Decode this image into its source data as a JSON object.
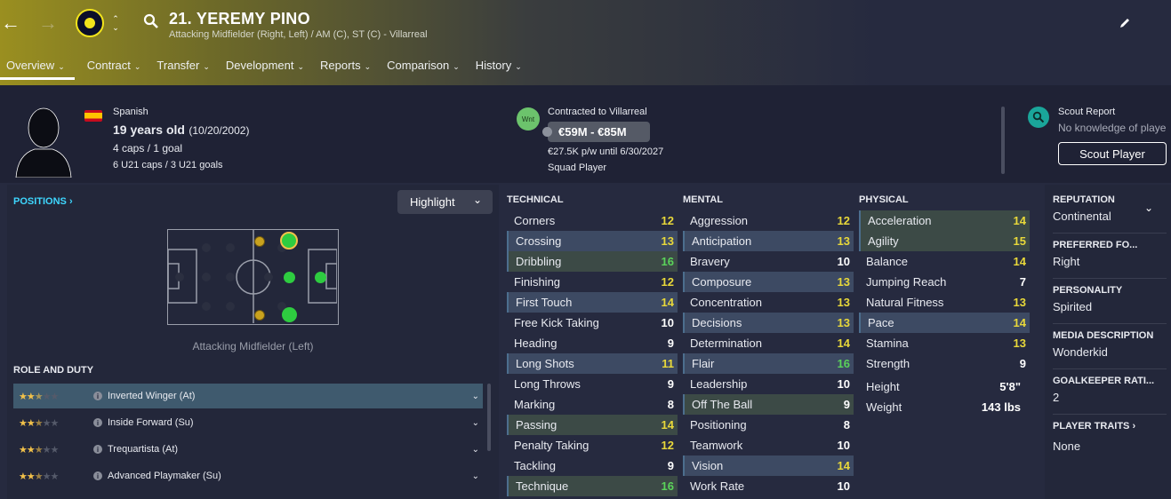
{
  "header": {
    "player_name": "21. YEREMY PINO",
    "subtitle": "Attacking Midfielder (Right, Left) / AM (C), ST (C) - Villarreal"
  },
  "tabs": [
    {
      "label": "Overview"
    },
    {
      "label": "Contract"
    },
    {
      "label": "Transfer"
    },
    {
      "label": "Development"
    },
    {
      "label": "Reports"
    },
    {
      "label": "Comparison"
    },
    {
      "label": "History"
    }
  ],
  "profile": {
    "nationality": "Spanish",
    "age": "19 years old",
    "dob": "(10/20/2002)",
    "caps": "4 caps / 1 goal",
    "u21": "6 U21 caps / 3 U21 goals"
  },
  "contract": {
    "status_badge": "Wnt",
    "contracted_to": "Contracted to Villarreal",
    "value_range": "€59M - €85M",
    "wage": "€27.5K p/w until 6/30/2027",
    "squad_status": "Squad Player"
  },
  "scout": {
    "title": "Scout Report",
    "knowledge": "No knowledge of playe",
    "button": "Scout Player"
  },
  "positions": {
    "title": "POSITIONS",
    "highlight_label": "Highlight",
    "caption": "Attacking Midfielder (Left)"
  },
  "roles": {
    "title": "ROLE AND DUTY",
    "items": [
      {
        "name": "Inverted Winger (At)",
        "stars": 2.5
      },
      {
        "name": "Inside Forward (Su)",
        "stars": 2.5
      },
      {
        "name": "Trequartista (At)",
        "stars": 2.5
      },
      {
        "name": "Advanced Playmaker (Su)",
        "stars": 2.5
      }
    ]
  },
  "technical": {
    "title": "TECHNICAL",
    "items": [
      {
        "name": "Corners",
        "value": "12"
      },
      {
        "name": "Crossing",
        "value": "13"
      },
      {
        "name": "Dribbling",
        "value": "16"
      },
      {
        "name": "Finishing",
        "value": "12"
      },
      {
        "name": "First Touch",
        "value": "14"
      },
      {
        "name": "Free Kick Taking",
        "value": "10"
      },
      {
        "name": "Heading",
        "value": "9"
      },
      {
        "name": "Long Shots",
        "value": "11"
      },
      {
        "name": "Long Throws",
        "value": "9"
      },
      {
        "name": "Marking",
        "value": "8"
      },
      {
        "name": "Passing",
        "value": "14"
      },
      {
        "name": "Penalty Taking",
        "value": "12"
      },
      {
        "name": "Tackling",
        "value": "9"
      },
      {
        "name": "Technique",
        "value": "16"
      }
    ]
  },
  "mental": {
    "title": "MENTAL",
    "items": [
      {
        "name": "Aggression",
        "value": "12"
      },
      {
        "name": "Anticipation",
        "value": "13"
      },
      {
        "name": "Bravery",
        "value": "10"
      },
      {
        "name": "Composure",
        "value": "13"
      },
      {
        "name": "Concentration",
        "value": "13"
      },
      {
        "name": "Decisions",
        "value": "13"
      },
      {
        "name": "Determination",
        "value": "14"
      },
      {
        "name": "Flair",
        "value": "16"
      },
      {
        "name": "Leadership",
        "value": "10"
      },
      {
        "name": "Off The Ball",
        "value": "9"
      },
      {
        "name": "Positioning",
        "value": "8"
      },
      {
        "name": "Teamwork",
        "value": "10"
      },
      {
        "name": "Vision",
        "value": "14"
      },
      {
        "name": "Work Rate",
        "value": "10"
      }
    ]
  },
  "physical": {
    "title": "PHYSICAL",
    "items": [
      {
        "name": "Acceleration",
        "value": "14"
      },
      {
        "name": "Agility",
        "value": "15"
      },
      {
        "name": "Balance",
        "value": "14"
      },
      {
        "name": "Jumping Reach",
        "value": "7"
      },
      {
        "name": "Natural Fitness",
        "value": "13"
      },
      {
        "name": "Pace",
        "value": "14"
      },
      {
        "name": "Stamina",
        "value": "13"
      },
      {
        "name": "Strength",
        "value": "9"
      }
    ],
    "height_label": "Height",
    "height": "5'8\"",
    "weight_label": "Weight",
    "weight": "143 lbs"
  },
  "side": {
    "reputation_label": "REPUTATION",
    "reputation": "Continental",
    "foot_label": "PREFERRED FO...",
    "foot": "Right",
    "personality_label": "PERSONALITY",
    "personality": "Spirited",
    "media_label": "MEDIA DESCRIPTION",
    "media": "Wonderkid",
    "gk_label": "GOALKEEPER RATI...",
    "gk": "2",
    "traits_label": "PLAYER TRAITS",
    "traits": "None"
  },
  "colors": {
    "accent_cyan": "#3ed7ff",
    "value_white": "#ffffff",
    "value_yellow": "#e8d83a",
    "value_green": "#5ad35a"
  }
}
